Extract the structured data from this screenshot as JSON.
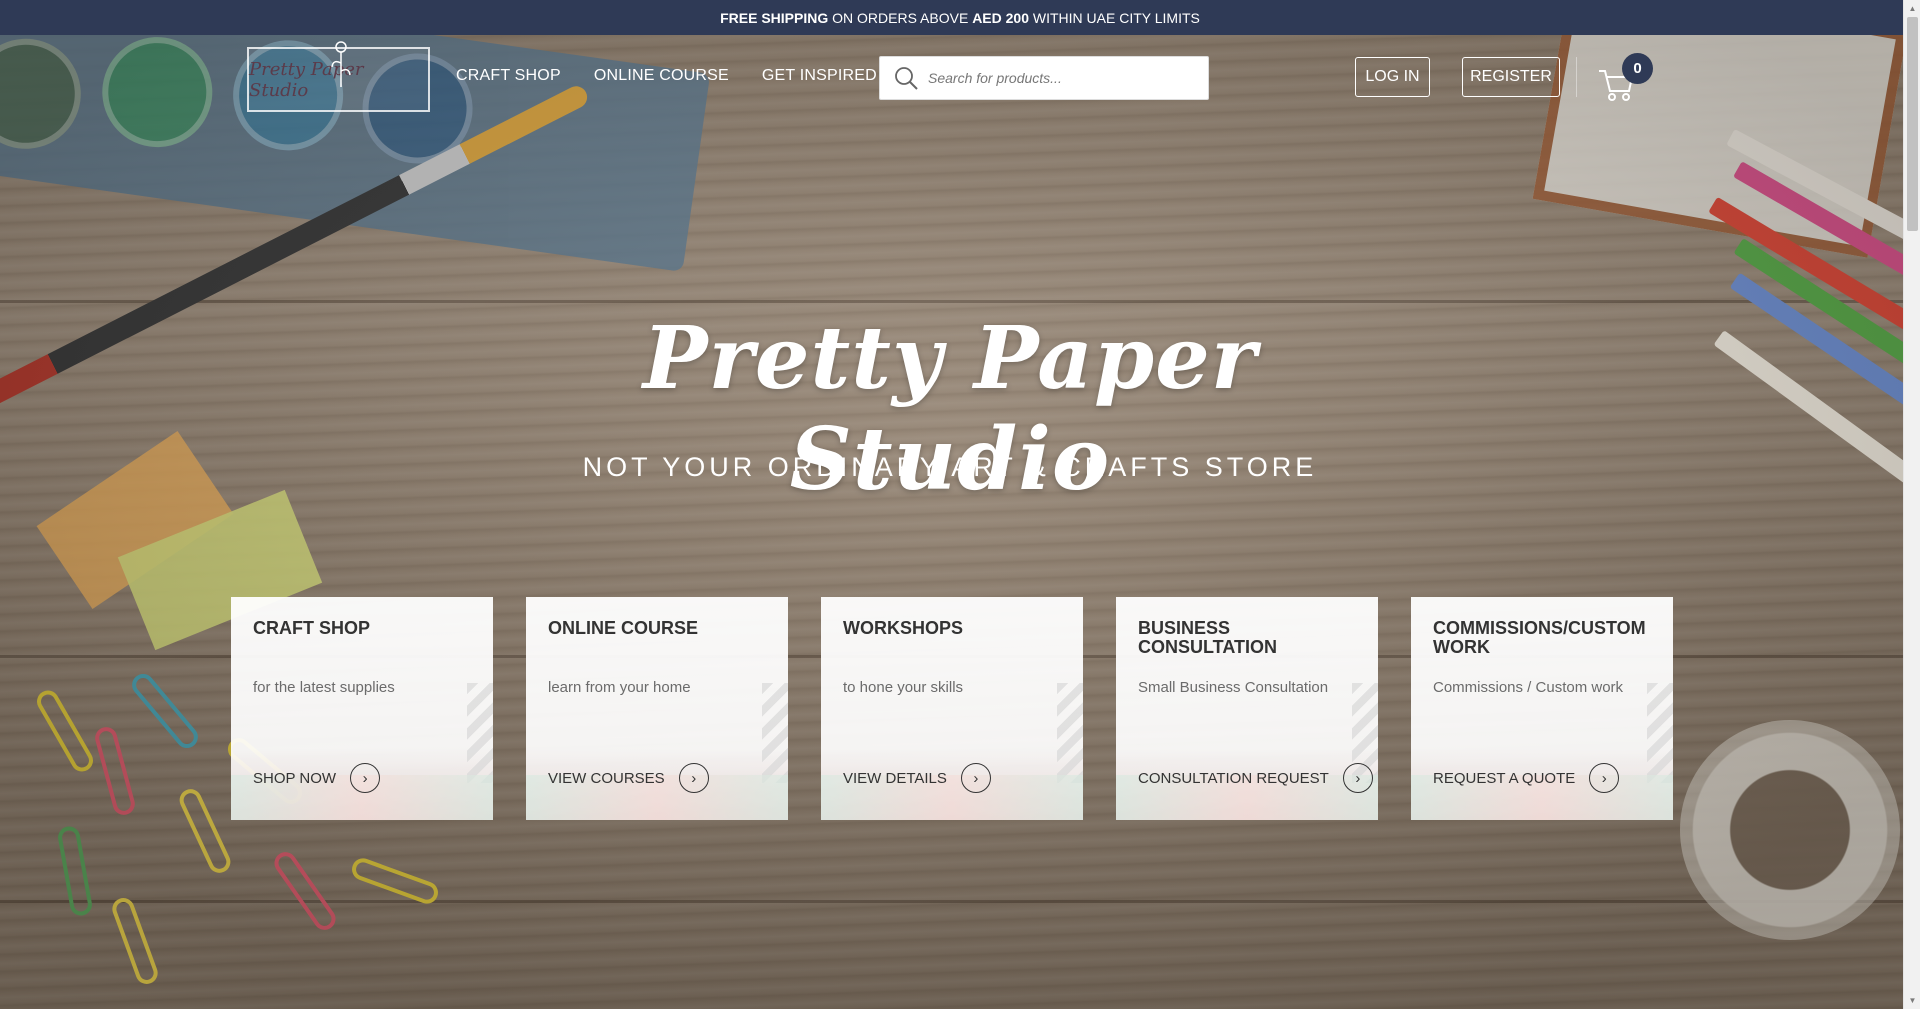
{
  "announcement": {
    "part1_bold": "FREE SHIPPING",
    "part2": " ON ORDERS ABOVE ",
    "part3_bold": "AED 200",
    "part4": " WITHIN UAE CITY LIMITS"
  },
  "header": {
    "logo_text": "Pretty Paper Studio",
    "nav": [
      {
        "label": "CRAFT SHOP"
      },
      {
        "label": "ONLINE COURSE"
      },
      {
        "label": "GET INSPIRED"
      }
    ],
    "search": {
      "placeholder": "Search for products..."
    },
    "login_label": "LOG IN",
    "register_label": "REGISTER",
    "cart_count": "0"
  },
  "hero": {
    "title": "Pretty Paper Studio",
    "tagline": "NOT YOUR ORDINARY ART & CRAFTS STORE"
  },
  "cards": [
    {
      "title": "CRAFT SHOP",
      "subtitle": "for the latest supplies",
      "cta": "SHOP NOW"
    },
    {
      "title": "ONLINE COURSE",
      "subtitle": "learn from your home",
      "cta": "VIEW COURSES"
    },
    {
      "title": "WORKSHOPS",
      "subtitle": "to hone your skills",
      "cta": "VIEW DETAILS"
    },
    {
      "title": "BUSINESS CONSULTATION",
      "subtitle": "Small Business Consultation",
      "cta": "CONSULTATION REQUEST"
    },
    {
      "title": "COMMISSIONS/CUSTOM WORK",
      "subtitle": "Commissions / Custom work",
      "cta": "REQUEST A QUOTE"
    }
  ],
  "colors": {
    "topbar_bg": "#2f3a56",
    "text_dark": "#333333",
    "text_muted": "#6b6b6b"
  },
  "icons": {
    "search": "search-icon",
    "cart": "cart-icon",
    "chevron": "chevron-down-icon",
    "arrow": "arrow-right-icon"
  }
}
